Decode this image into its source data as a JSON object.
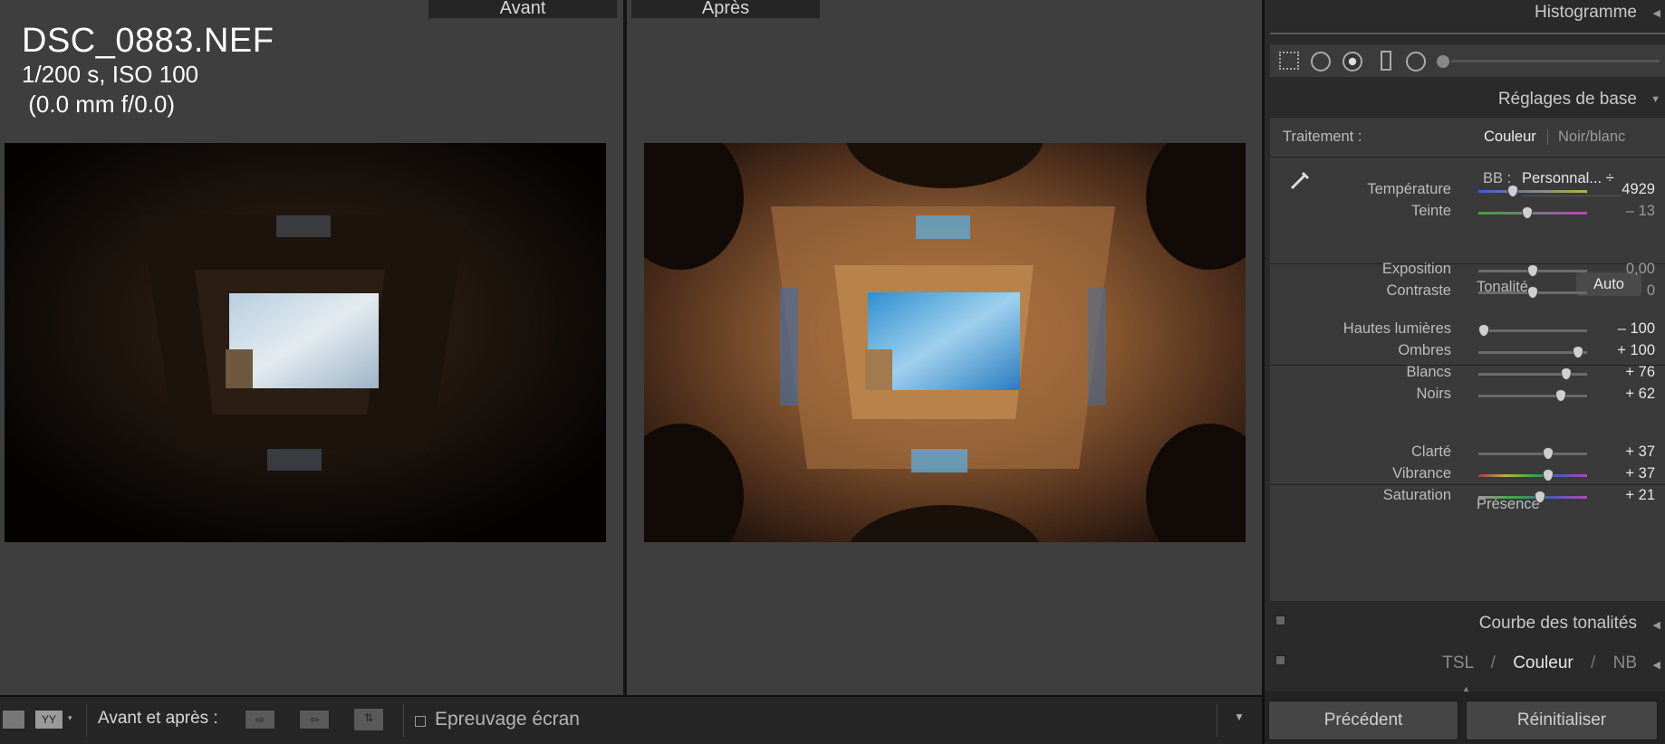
{
  "viewer": {
    "before_label": "Avant",
    "after_label": "Après",
    "file_name": "DSC_0883.NEF",
    "exposure_line": "1/200 s, ISO 100",
    "lens_line": " (0.0 mm f/0.0)"
  },
  "toolbar": {
    "view_mode_label": "YY",
    "before_after_label": "Avant et après :",
    "softproof_label": "Epreuvage écran"
  },
  "panel": {
    "histogram_title": "Histogramme",
    "basic_title": "Réglages de base",
    "treatment_label": "Traitement :",
    "treatment_color": "Couleur",
    "treatment_bw": "Noir/blanc",
    "wb_label": "BB :",
    "wb_value": "Personnal... ÷",
    "tone_title": "Tonalité",
    "auto_label": "Auto",
    "presence_title": "Présence",
    "tone_curve_title": "Courbe des tonalités",
    "hsl_tsl": "TSL",
    "hsl_color": "Couleur",
    "hsl_nb": "NB",
    "slash": "/",
    "prev_button": "Précédent",
    "reset_button": "Réinitialiser",
    "sliders": [
      {
        "label": "Température",
        "value": "4929",
        "pos": 0.32
      },
      {
        "label": "Teinte",
        "value": "– 13",
        "pos": 0.45
      },
      {
        "label": "Exposition",
        "value": "0,00",
        "pos": 0.5
      },
      {
        "label": "Contraste",
        "value": "0",
        "pos": 0.5
      },
      {
        "label": "Hautes lumières",
        "value": "– 100",
        "pos": 0.05
      },
      {
        "label": "Ombres",
        "value": "+ 100",
        "pos": 0.92
      },
      {
        "label": "Blancs",
        "value": "+ 76",
        "pos": 0.81
      },
      {
        "label": "Noirs",
        "value": "+ 62",
        "pos": 0.76
      },
      {
        "label": "Clarté",
        "value": "+ 37",
        "pos": 0.64
      },
      {
        "label": "Vibrance",
        "value": "+ 37",
        "pos": 0.64
      },
      {
        "label": "Saturation",
        "value": "+ 21",
        "pos": 0.57
      }
    ]
  }
}
